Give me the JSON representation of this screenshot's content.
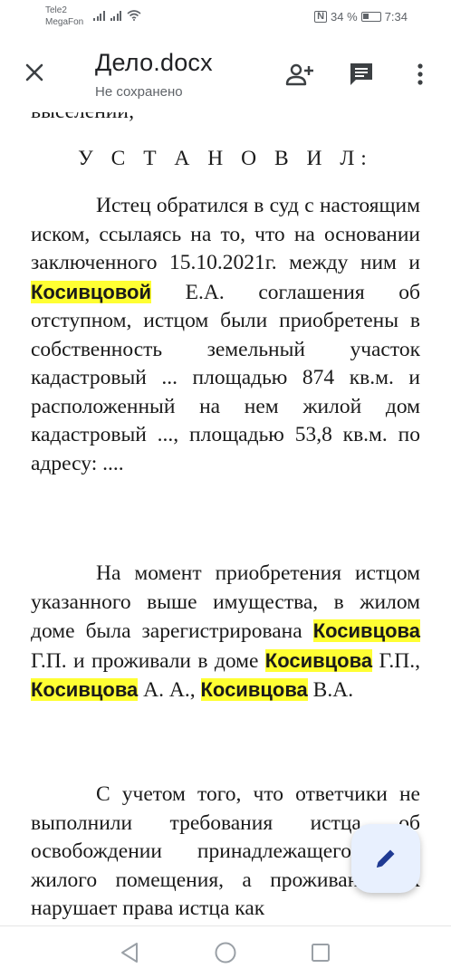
{
  "status_bar": {
    "carrier1": "Tele2",
    "carrier2": "MegaFon",
    "battery": "34 %",
    "time": "7:34"
  },
  "app_bar": {
    "title": "Дело.docx",
    "subtitle": "Не сохранено",
    "icons": [
      "close-icon",
      "add-person-icon",
      "comment-icon",
      "more-vert-icon"
    ]
  },
  "document": {
    "cut_line": "выселении;",
    "heading": "У С Т А Н О В И Л:",
    "p1": {
      "a": "Истец обратился в суд с настоящим иском, ссылаясь на то, что на основании заключенного 15.10.2021г. между ним и ",
      "h1": "Косивцовой",
      "b": " Е.А. соглашения об отступном, истцом были приобретены в собственность земельный участок кадастровый ... площадью 874 кв.м. и расположенный на нем жилой дом кадастровый ..., площадью 53,8 кв.м. по адресу: ...."
    },
    "p2": {
      "a": "На момент приобретения истцом указанного выше имущества, в жилом доме была зарегистрирована ",
      "h1": "Косивцова",
      "b": " Г.П.  и проживали в доме ",
      "h2": "Косивцова",
      "c": " Г.П., ",
      "h3": "Косивцова",
      "d": " А. А., ",
      "h4": "Косивцова",
      "e": " В.А."
    },
    "p3": {
      "a": "С учетом того, что ответчики не выполнили требования истца об освобождении принадлежащего ему жилого помещения, а проживание их нарушает права истца как"
    },
    "highlight_color": "#ffff33"
  },
  "fab": {
    "icon": "edit-pencil-icon",
    "color": "#e8f0fe"
  },
  "nav_bar": {
    "icons": [
      "back-icon",
      "home-icon",
      "recents-icon"
    ]
  }
}
